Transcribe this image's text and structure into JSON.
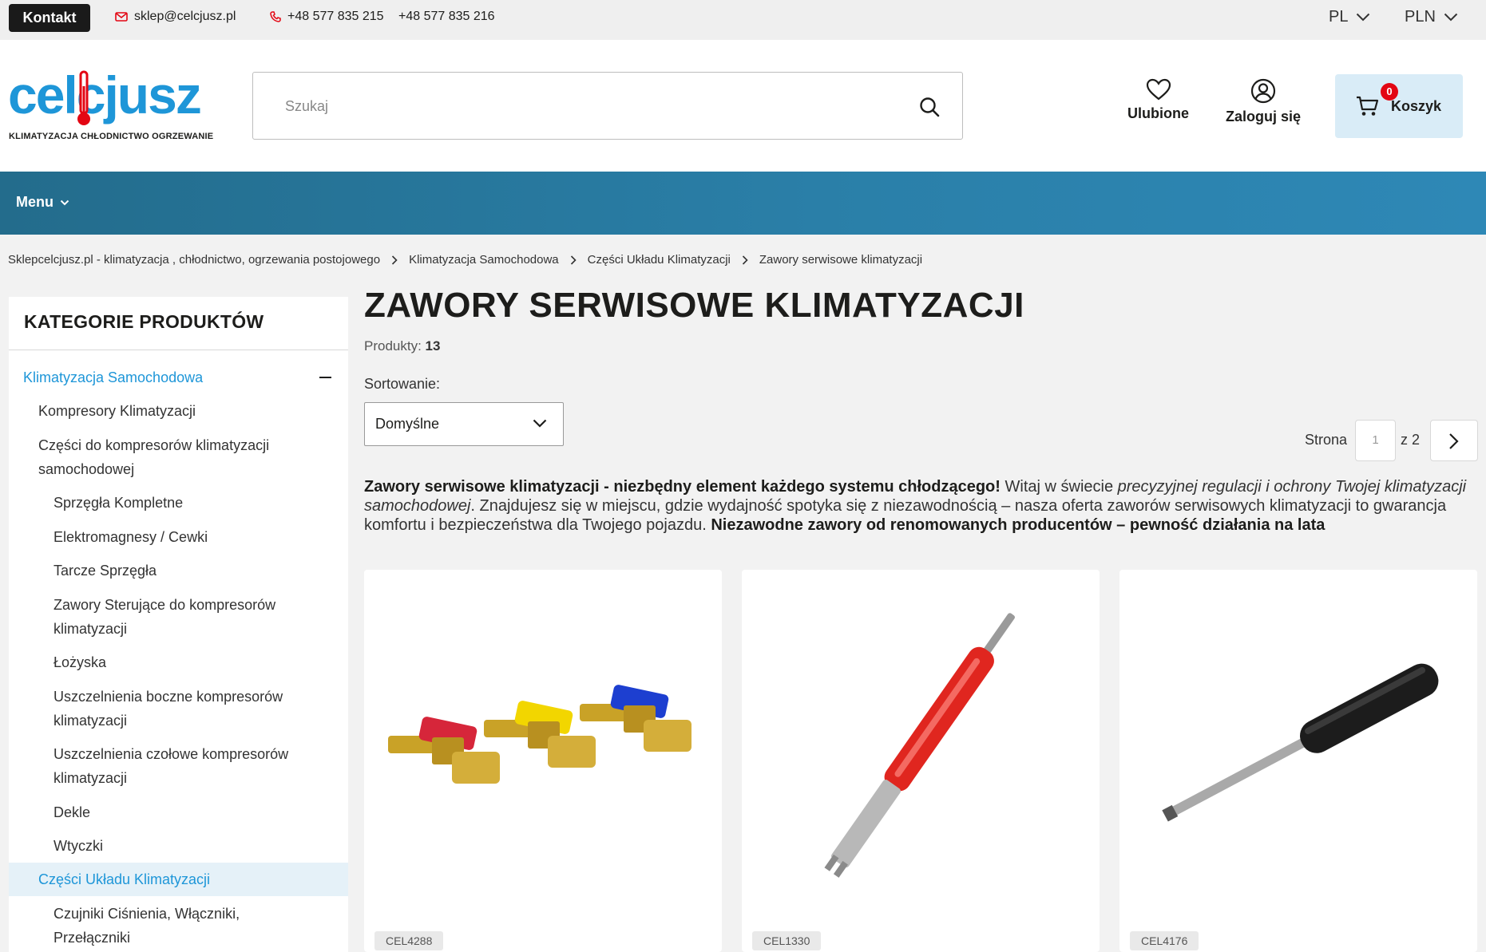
{
  "topbar": {
    "contact_label": "Kontakt",
    "email": "sklep@celcjusz.pl",
    "phone1": "+48 577 835 215",
    "phone2": "+48 577 835 216",
    "language": "PL",
    "currency": "PLN"
  },
  "header": {
    "logo_text": "celcjusz",
    "logo_tagline": "KLIMATYZACJA CHŁODNICTWO OGRZEWANIE",
    "search_placeholder": "Szukaj",
    "favorites_label": "Ulubione",
    "login_label": "Zaloguj się",
    "cart_label": "Koszyk",
    "cart_count": "0"
  },
  "nav": {
    "menu_label": "Menu"
  },
  "breadcrumb": [
    "Sklepcelcjusz.pl - klimatyzacja , chłodnictwo, ogrzewania postojowego",
    "Klimatyzacja Samochodowa",
    "Części Układu Klimatyzacji",
    "Zawory serwisowe klimatyzacji"
  ],
  "sidebar": {
    "title": "KATEGORIE PRODUKTÓW",
    "items": [
      "Klimatyzacja Samochodowa",
      "Kompresory Klimatyzacji",
      "Części do kompresorów klimatyzacji",
      "samochodowej",
      "Sprzęgła Kompletne",
      "Elektromagnesy / Cewki",
      "Tarcze Sprzęgła",
      "Zawory Sterujące do kompresorów",
      "klimatyzacji",
      "Łożyska",
      "Uszczelnienia boczne kompresorów",
      "klimatyzacji",
      "Uszczelnienia czołowe kompresorów",
      "klimatyzacji",
      "Dekle",
      "Wtyczki",
      "Części Układu Klimatyzacji",
      "Czujniki Ciśnienia, Włączniki,",
      "Przełączniki"
    ]
  },
  "main": {
    "title": "ZAWORY SERWISOWE KLIMATYZACJI",
    "products_label": "Produkty:",
    "products_count": "13",
    "sort_label": "Sortowanie:",
    "sort_value": "Domyślne",
    "pager_label": "Strona",
    "pager_current": "1",
    "pager_of": "z 2",
    "desc_bold1": "Zawory serwisowe klimatyzacji - niezbędny element każdego systemu chłodzącego!",
    "desc_text1": " Witaj w świecie ",
    "desc_italic": "precyzyjnej regulacji i ochrony Twojej klimatyzacji samochodowej",
    "desc_text2": ". Znajdujesz się w miejscu, gdzie wydajność spotyka się z niezawodnością – nasza oferta zaworów serwisowych klimatyzacji to gwarancja komfortu i bezpieczeństwa dla Twojego pojazdu. ",
    "desc_bold2": "Niezawodne zawory od renomowanych producentów – pewność działania na lata"
  },
  "products": [
    {
      "sku": "CEL4288"
    },
    {
      "sku": "CEL1330"
    },
    {
      "sku": "CEL4176"
    }
  ],
  "colors": {
    "accent": "#1e96d8",
    "nav_band": "#2a7fa8",
    "badge": "#e30613"
  }
}
